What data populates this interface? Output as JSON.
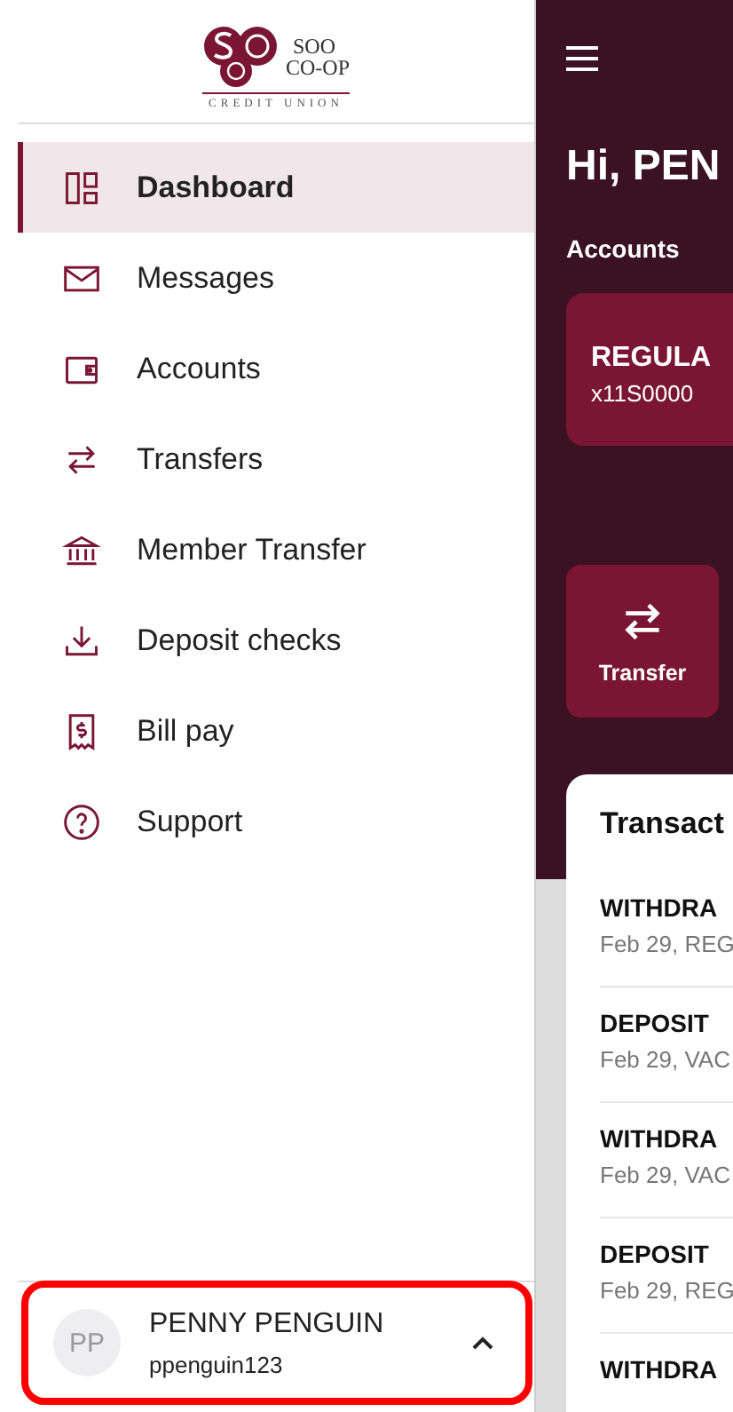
{
  "logo": {
    "line_1": "SOO",
    "line_2": "CO-OP",
    "tagline": "CREDIT UNION"
  },
  "nav": [
    {
      "label": "Dashboard",
      "selected": true
    },
    {
      "label": "Messages",
      "selected": false
    },
    {
      "label": "Accounts",
      "selected": false
    },
    {
      "label": "Transfers",
      "selected": false
    },
    {
      "label": "Member Transfer",
      "selected": false
    },
    {
      "label": "Deposit checks",
      "selected": false
    },
    {
      "label": "Bill pay",
      "selected": false
    },
    {
      "label": "Support",
      "selected": false
    }
  ],
  "user": {
    "initials": "PP",
    "name": "PENNY PENGUIN",
    "username": "ppenguin123",
    "expanded": true
  },
  "main": {
    "greeting": "Hi, PEN",
    "accounts_label": "Accounts",
    "account": {
      "name": "REGULA",
      "number": "x11S0000"
    },
    "action": {
      "label": "Transfer"
    },
    "transactions": {
      "title": "Transact",
      "rows": [
        {
          "title": "WITHDRA",
          "subtitle": "Feb 29, REG"
        },
        {
          "title": "DEPOSIT",
          "subtitle": "Feb 29, VAC"
        },
        {
          "title": "WITHDRA",
          "subtitle": "Feb 29, VAC"
        },
        {
          "title": "DEPOSIT",
          "subtitle": "Feb 29, REG"
        },
        {
          "title": "WITHDRA",
          "subtitle": ""
        }
      ]
    }
  }
}
